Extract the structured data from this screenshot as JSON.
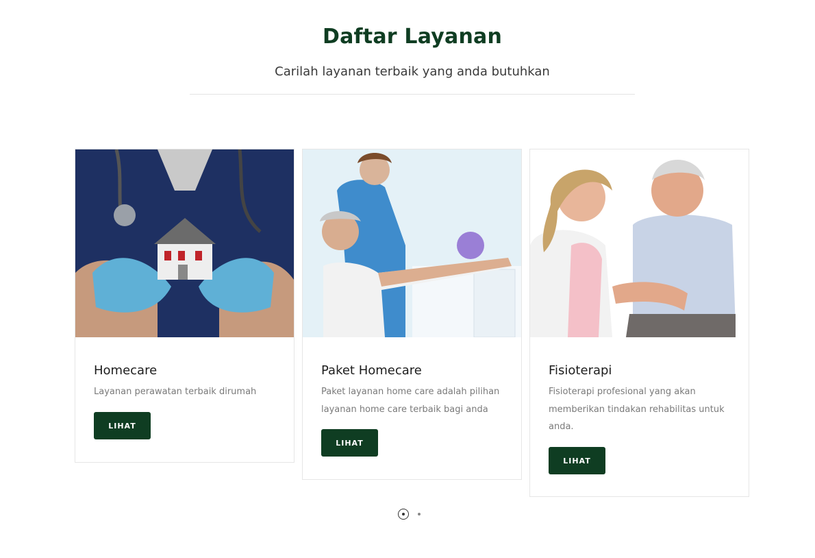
{
  "section": {
    "title": "Daftar Layanan",
    "subtitle": "Carilah layanan terbaik yang anda butuhkan"
  },
  "cards": [
    {
      "title": "Homecare",
      "description": "Layanan perawatan terbaik dirumah",
      "button_label": "LIHAT",
      "image": "nurse-holding-house-photo"
    },
    {
      "title": "Paket Homecare",
      "description": "Paket layanan home care adalah pilihan layanan home care terbaik bagi anda",
      "button_label": "LIHAT",
      "image": "physiotherapy-session-photo"
    },
    {
      "title": "Fisioterapi",
      "description": "Fisioterapi profesional yang akan memberikan tindakan rehabilitas untuk anda.",
      "button_label": "LIHAT",
      "image": "nurse-with-elderly-man-photo"
    }
  ],
  "pagination": {
    "pages": 2,
    "active": 1
  },
  "colors": {
    "brand": "#0f3d22",
    "text_muted": "#7a7a7a",
    "border": "#e6e6e6"
  }
}
